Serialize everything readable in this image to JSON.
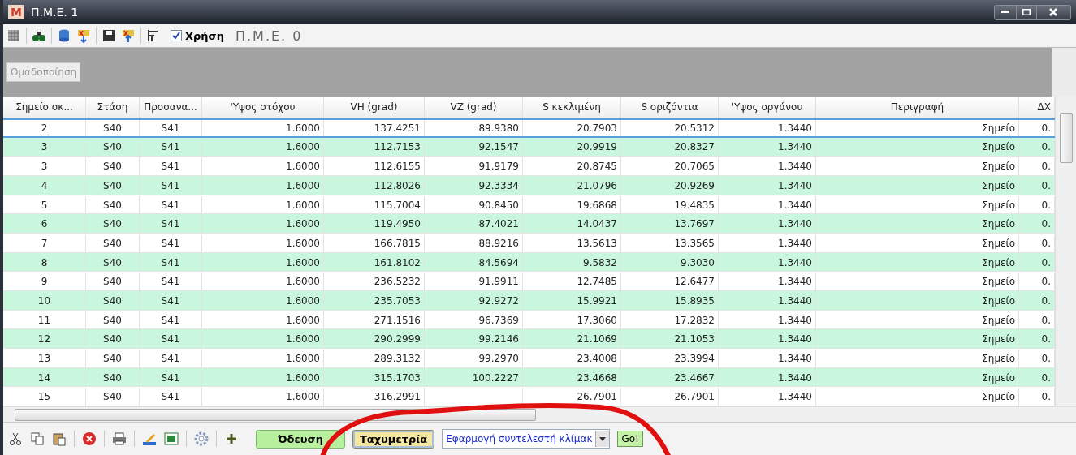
{
  "window": {
    "title": "Π.Μ.Ε. 1",
    "app_letter": "M"
  },
  "toolbar": {
    "use_checkbox": {
      "label": "Χρήση",
      "checked": true
    },
    "pme_label": "Π.Μ.Ε. 0"
  },
  "group_button": {
    "label": "Ομαδοποίηση",
    "disabled": true
  },
  "table": {
    "columns": [
      "Σημείο σκ...",
      "Στάση",
      "Προσανα...",
      "'Υψος στόχου",
      "VH (grad)",
      "VZ (grad)",
      "S κεκλιμένη",
      "S οριζόντια",
      "'Υψος οργάνου",
      "Περιγραφή",
      "ΔΧ"
    ],
    "rows": [
      {
        "selected": true,
        "cells": [
          "2",
          "S40",
          "S41",
          "1.6000",
          "137.4251",
          "89.9380",
          "20.7903",
          "20.5312",
          "1.3440",
          "Σημείο",
          "0."
        ]
      },
      {
        "selected": false,
        "cells": [
          "3",
          "S40",
          "S41",
          "1.6000",
          "112.7153",
          "92.1547",
          "20.9919",
          "20.8327",
          "1.3440",
          "Σημείο",
          "0."
        ]
      },
      {
        "selected": false,
        "cells": [
          "3",
          "S40",
          "S41",
          "1.6000",
          "112.6155",
          "91.9179",
          "20.8745",
          "20.7065",
          "1.3440",
          "Σημείο",
          "0."
        ]
      },
      {
        "selected": false,
        "cells": [
          "4",
          "S40",
          "S41",
          "1.6000",
          "112.8026",
          "92.3334",
          "21.0796",
          "20.9269",
          "1.3440",
          "Σημείο",
          "0."
        ]
      },
      {
        "selected": false,
        "cells": [
          "5",
          "S40",
          "S41",
          "1.6000",
          "115.7004",
          "90.8450",
          "19.6868",
          "19.4835",
          "1.3440",
          "Σημείο",
          "0."
        ]
      },
      {
        "selected": false,
        "cells": [
          "6",
          "S40",
          "S41",
          "1.6000",
          "119.4950",
          "87.4021",
          "14.0437",
          "13.7697",
          "1.3440",
          "Σημείο",
          "0."
        ]
      },
      {
        "selected": false,
        "cells": [
          "7",
          "S40",
          "S41",
          "1.6000",
          "166.7815",
          "88.9216",
          "13.5613",
          "13.3565",
          "1.3440",
          "Σημείο",
          "0."
        ]
      },
      {
        "selected": false,
        "cells": [
          "8",
          "S40",
          "S41",
          "1.6000",
          "161.8102",
          "84.5694",
          "9.5832",
          "9.3030",
          "1.3440",
          "Σημείο",
          "0."
        ]
      },
      {
        "selected": false,
        "cells": [
          "9",
          "S40",
          "S41",
          "1.6000",
          "236.5232",
          "91.9911",
          "12.7485",
          "12.6477",
          "1.3440",
          "Σημείο",
          "0."
        ]
      },
      {
        "selected": false,
        "cells": [
          "10",
          "S40",
          "S41",
          "1.6000",
          "235.7053",
          "92.9272",
          "15.9921",
          "15.8935",
          "1.3440",
          "Σημείο",
          "0."
        ]
      },
      {
        "selected": false,
        "cells": [
          "11",
          "S40",
          "S41",
          "1.6000",
          "271.1516",
          "96.7369",
          "17.3060",
          "17.2832",
          "1.3440",
          "Σημείο",
          "0."
        ]
      },
      {
        "selected": false,
        "cells": [
          "12",
          "S40",
          "S41",
          "1.6000",
          "290.2999",
          "99.2146",
          "21.1069",
          "21.1053",
          "1.3440",
          "Σημείο",
          "0."
        ]
      },
      {
        "selected": false,
        "cells": [
          "13",
          "S40",
          "S41",
          "1.6000",
          "289.3132",
          "99.2970",
          "23.4008",
          "23.3994",
          "1.3440",
          "Σημείο",
          "0."
        ]
      },
      {
        "selected": false,
        "cells": [
          "14",
          "S40",
          "S41",
          "1.6000",
          "315.1703",
          "100.2227",
          "23.4668",
          "23.4667",
          "1.3440",
          "Σημείο",
          "0."
        ]
      },
      {
        "selected": false,
        "cells": [
          "15",
          "S40",
          "S41",
          "1.6000",
          "316.2991",
          null,
          "26.7901",
          "26.7901",
          "1.3440",
          "Σημείο",
          "0."
        ]
      }
    ]
  },
  "bottom_toolbar": {
    "traverse_button": {
      "label": "Όδευση",
      "selected": false
    },
    "tacheometry_button": {
      "label": "Ταχυμετρία",
      "selected": true
    },
    "action_select": {
      "value": "Εφαρμογή συντελεστή κλίμακ"
    },
    "go_button": {
      "label": "Go!"
    }
  }
}
